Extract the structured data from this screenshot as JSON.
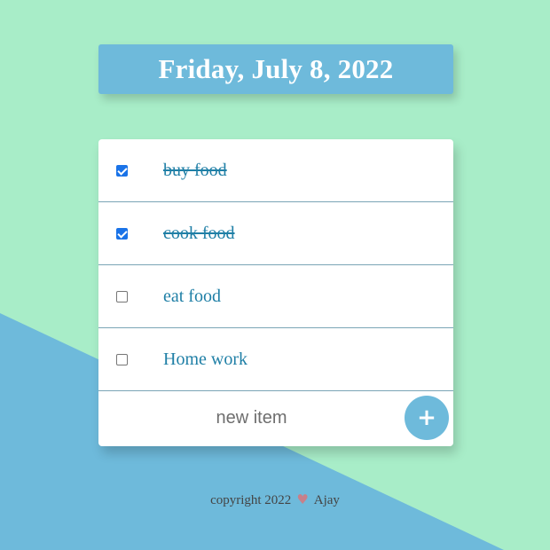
{
  "header": {
    "date": "Friday, July 8, 2022"
  },
  "todo": {
    "items": [
      {
        "label": "buy food",
        "checked": true
      },
      {
        "label": "cook food",
        "checked": true
      },
      {
        "label": "eat food",
        "checked": false
      },
      {
        "label": "Home work",
        "checked": false
      }
    ],
    "new_item_placeholder": "new item",
    "add_label": "+"
  },
  "footer": {
    "copyright": "copyright 2022",
    "heart_icon": "heart-icon",
    "heart": "♥",
    "author": "Ajay"
  },
  "colors": {
    "background": "#a8edc8",
    "accent": "#6ebadb",
    "item_text": "#1f7fa6",
    "checkbox_checked": "#1a73e8"
  }
}
